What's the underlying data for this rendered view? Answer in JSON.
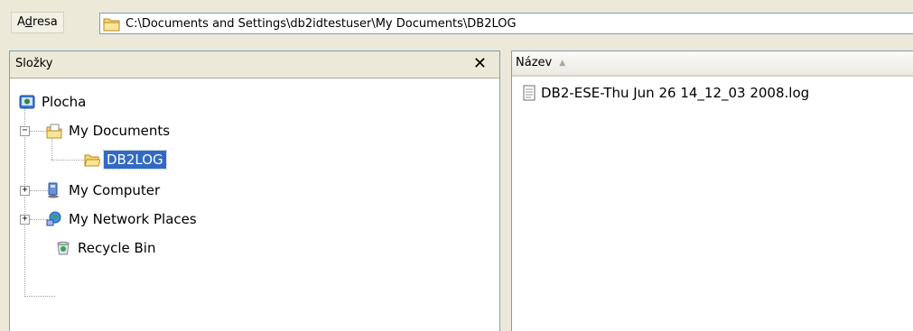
{
  "address_bar": {
    "label_pre": "A",
    "label_underlined": "d",
    "label_post": "resa",
    "path": "C:\\Documents and Settings\\db2idtestuser\\My Documents\\DB2LOG"
  },
  "folders_pane": {
    "title": "Složky",
    "close_glyph": "✕",
    "tree": [
      {
        "label": "Plocha",
        "icon": "desktop-icon"
      },
      {
        "label": "My Documents",
        "icon": "my-documents-icon",
        "expander": "−"
      },
      {
        "label": "DB2LOG",
        "icon": "folder-open-icon",
        "selected": true
      },
      {
        "label": "My Computer",
        "icon": "computer-icon",
        "expander": "+"
      },
      {
        "label": "My Network Places",
        "icon": "network-icon",
        "expander": "+"
      },
      {
        "label": "Recycle Bin",
        "icon": "recycle-bin-icon"
      }
    ]
  },
  "file_list": {
    "column_name": "Název",
    "sort_glyph": "▲",
    "files": [
      {
        "name": "DB2-ESE-Thu Jun 26 14_12_03 2008.log",
        "icon": "log-file-icon"
      }
    ]
  },
  "colors": {
    "selection": "#316ac5",
    "chrome": "#ece9d8",
    "border": "#7f9db9"
  }
}
